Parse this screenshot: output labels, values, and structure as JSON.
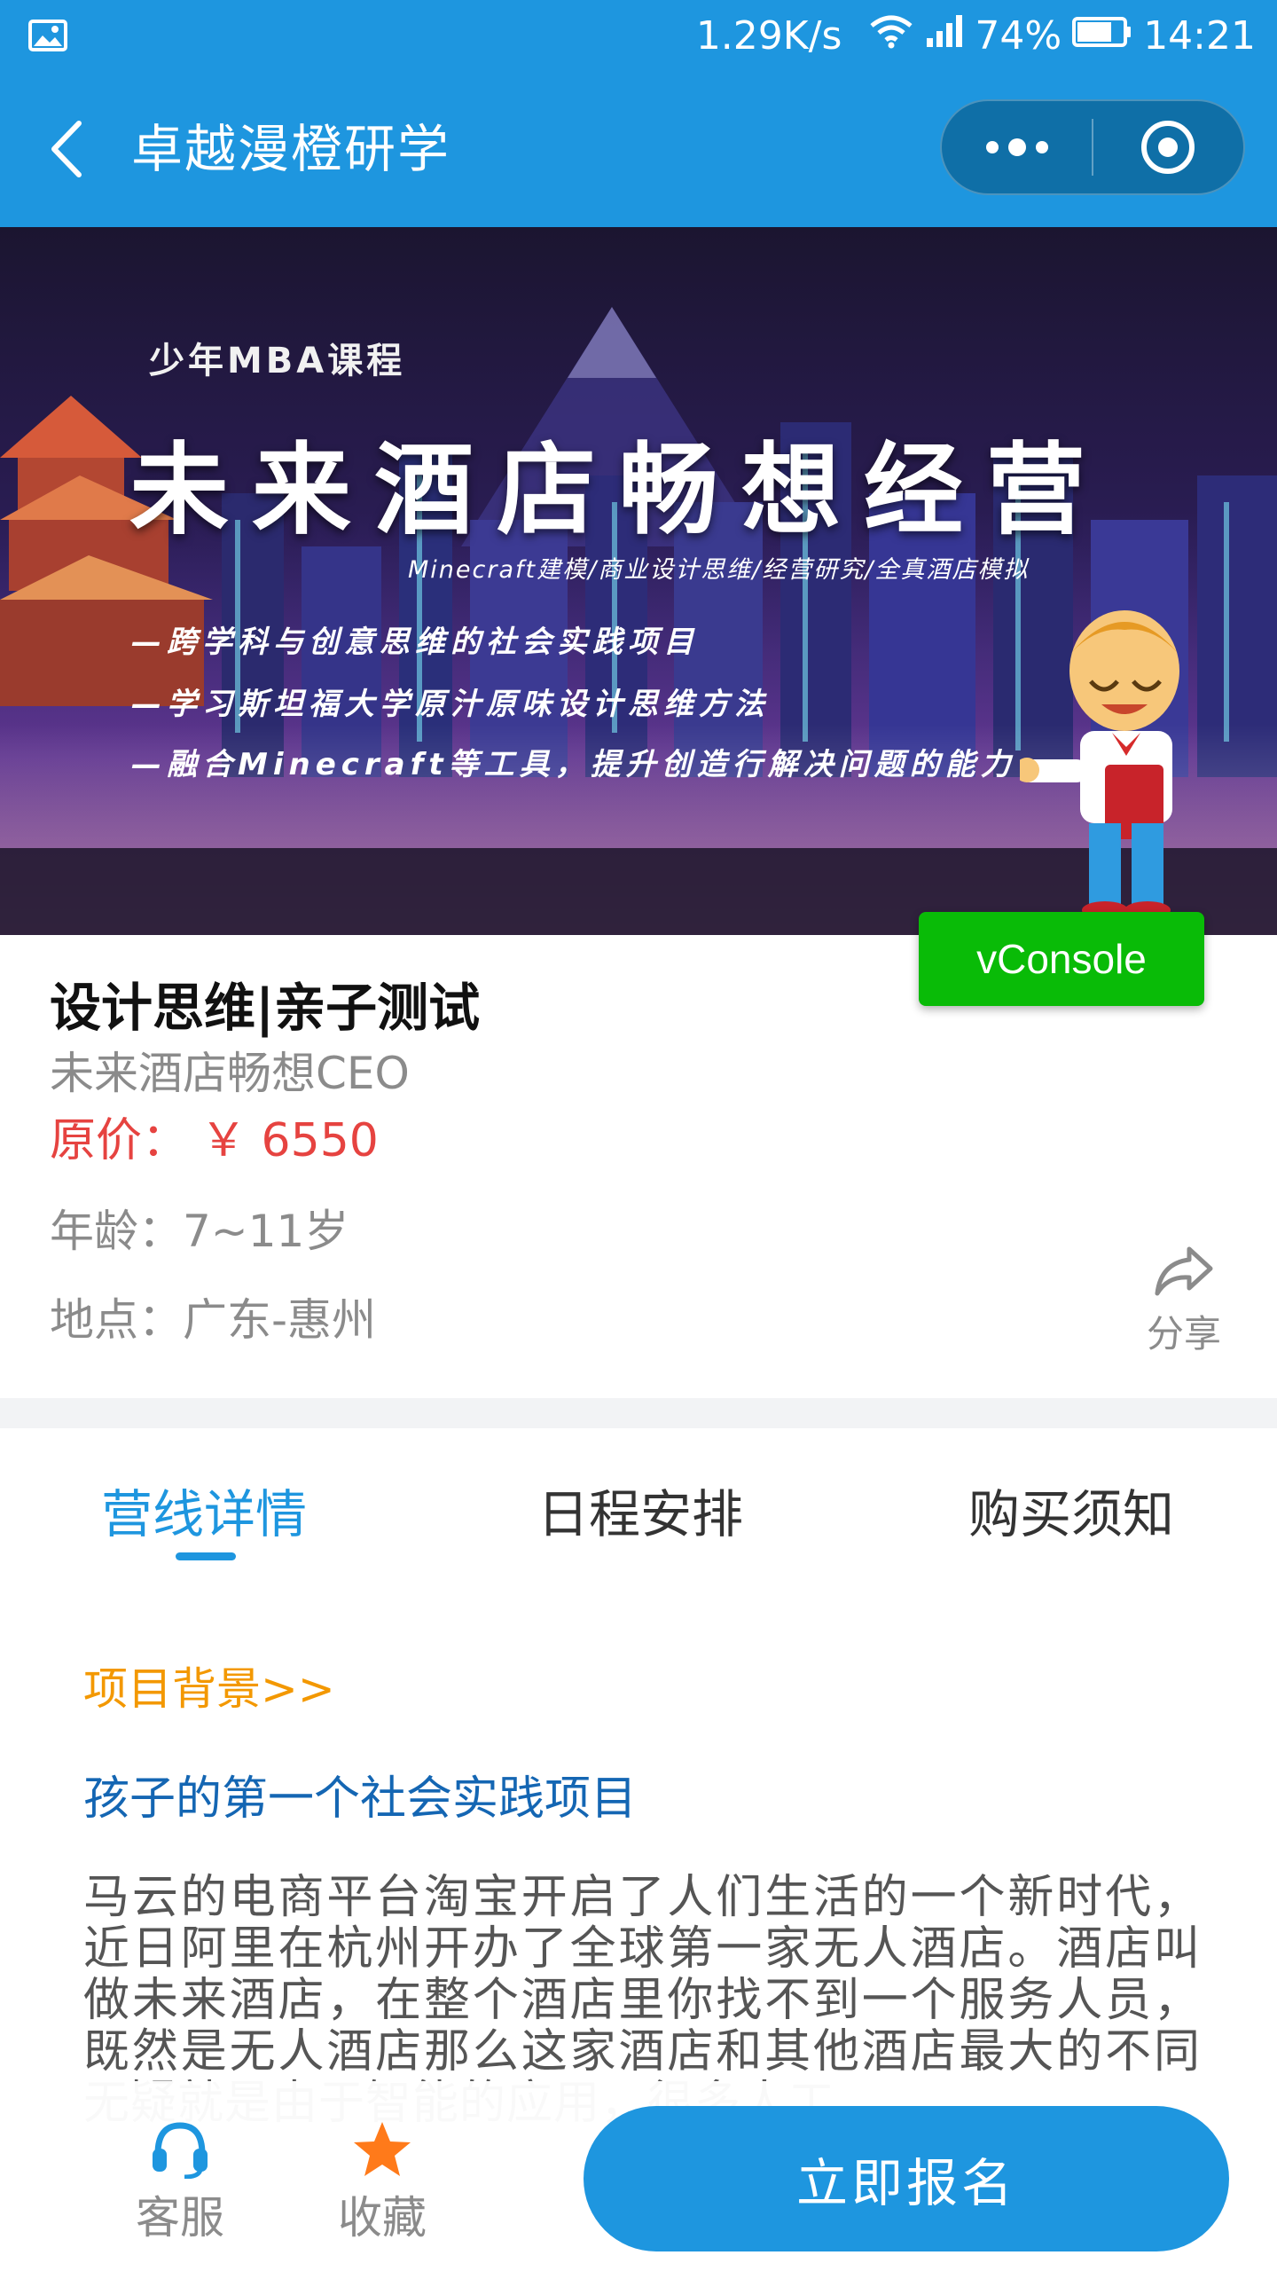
{
  "status_bar": {
    "speed": "1.29K/s",
    "battery": "74%",
    "time": "14:21"
  },
  "title_bar": {
    "title": "卓越漫橙研学"
  },
  "banner": {
    "subtitle": "少年MBA课程",
    "title": "未来酒店畅想经营",
    "tagline": "Minecraft建模/商业设计思维/经营研究/全真酒店模拟",
    "bullets": [
      "—跨学科与创意思维的社会实践项目",
      "—学习斯坦福大学原汁原味设计思维方法",
      "—融合Minecraft等工具，提升创造行解决问题的能力"
    ]
  },
  "vconsole": {
    "label": "vConsole"
  },
  "course": {
    "title": "设计思维|亲子测试",
    "subtitle": "未来酒店畅想CEO",
    "price_label": "原价：",
    "price_value": "￥ 6550",
    "age": "年龄：7~11岁",
    "location": "地点：广东-惠州"
  },
  "share": {
    "label": "分享"
  },
  "tabs": [
    {
      "label": "营线详情",
      "active": true
    },
    {
      "label": "日程安排",
      "active": false
    },
    {
      "label": "购买须知",
      "active": false
    }
  ],
  "content": {
    "section_heading": "项目背景>>",
    "subheading": "孩子的第一个社会实践项目",
    "body": "马云的电商平台淘宝开启了人们生活的一个新时代，近日阿里在杭州开办了全球第一家无人酒店。酒店叫做未来酒店，在整个酒店里你找不到一个服务人员，既然是无人酒店那么这家酒店和其他酒店最大的不同无疑就是由于智能的应用，很多人工"
  },
  "bottom_bar": {
    "service_label": "客服",
    "favorite_label": "收藏",
    "register_label": "立即报名"
  },
  "colors": {
    "primary": "#1e96df",
    "price": "#e64340",
    "heading_orange": "#f39800",
    "vconsole_green": "#09bb07",
    "star": "#ff7a1a"
  }
}
